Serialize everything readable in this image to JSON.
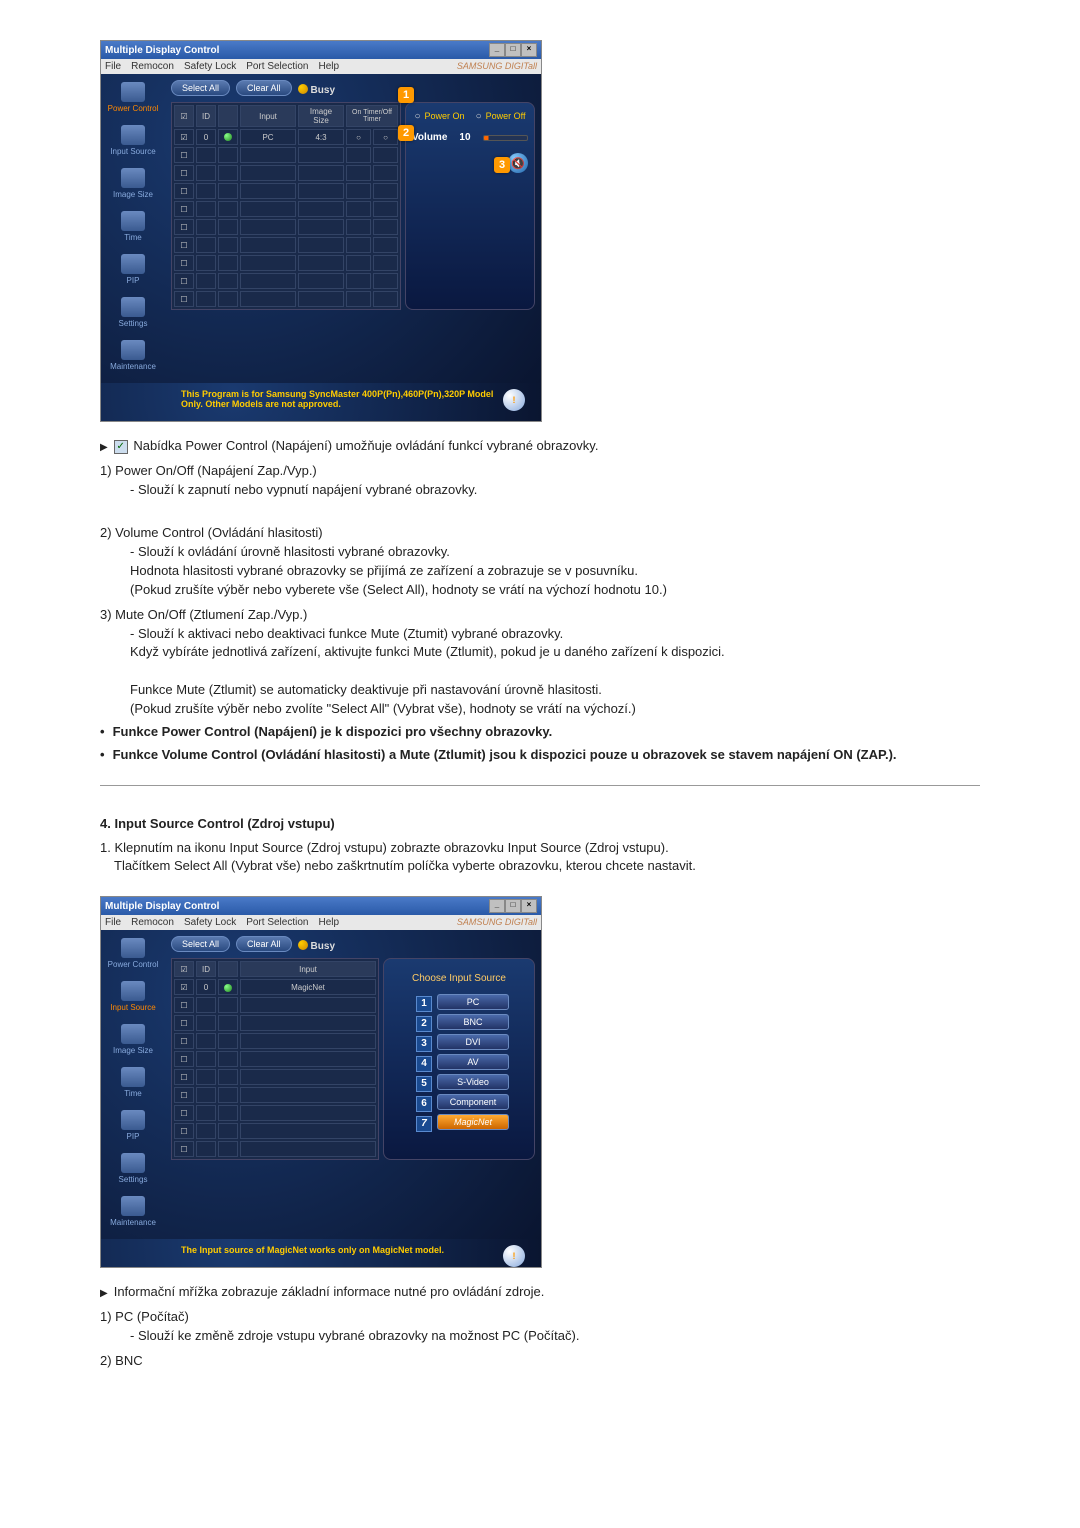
{
  "app": {
    "window_title": "Multiple Display Control",
    "menu": [
      "File",
      "Remocon",
      "Safety Lock",
      "Port Selection",
      "Help"
    ],
    "brand": "SAMSUNG DIGITall"
  },
  "sidebar": {
    "items": [
      {
        "label": "Power Control"
      },
      {
        "label": "Input Source"
      },
      {
        "label": "Image Size"
      },
      {
        "label": "Time"
      },
      {
        "label": "PIP"
      },
      {
        "label": "Settings"
      },
      {
        "label": "Maintenance"
      }
    ]
  },
  "toolbar": {
    "select_all": "Select All",
    "clear_all": "Clear All",
    "busy": "Busy"
  },
  "grid1": {
    "headers": [
      "☑",
      "ID",
      "",
      "Input",
      "Image Size",
      "On Timer/Off Timer"
    ],
    "row": {
      "id": "0",
      "input": "PC",
      "size": "4:3",
      "t1": "○",
      "t2": "○"
    }
  },
  "panel1": {
    "power_on": "Power On",
    "power_off": "Power Off",
    "volume_label": "Volume",
    "volume_value": "10",
    "markers": {
      "m1": "1",
      "m2": "2",
      "m3": "3"
    }
  },
  "footer1": "This Program is for Samsung SyncMaster 400P(Pn),460P(Pn),320P  Model Only. Other Models are not approved.",
  "section1": {
    "intro": "Nabídka Power Control (Napájení) umožňuje ovládání funkcí vybrané obrazovky.",
    "i1_title": "1)  Power On/Off (Napájení Zap./Vyp.)",
    "i1_s1": "Slouží k zapnutí nebo vypnutí napájení vybrané obrazovky.",
    "i2_title": "2)  Volume Control (Ovládání hlasitosti)",
    "i2_s1": "Slouží k ovládání úrovně hlasitosti vybrané obrazovky.",
    "i2_s2": "Hodnota hlasitosti vybrané obrazovky se přijímá ze zařízení a zobrazuje se v posuvníku.",
    "i2_s3": "(Pokud zrušíte výběr nebo vyberete vše (Select All), hodnoty se vrátí na výchozí hodnotu 10.)",
    "i3_title": "3)  Mute On/Off (Ztlumení Zap./Vyp.)",
    "i3_s1": "Slouží k aktivaci nebo deaktivaci funkce Mute (Ztumit) vybrané obrazovky.",
    "i3_s2": "Když vybíráte jednotlivá zařízení, aktivujte funkci Mute (Ztlumit), pokud je u daného zařízení k dispozici.",
    "i3_s3": "Funkce Mute (Ztlumit) se automaticky deaktivuje při nastavování úrovně hlasitosti.",
    "i3_s4": "(Pokud zrušíte výběr nebo zvolíte \"Select All\" (Vybrat vše), hodnoty se vrátí na výchozí.)",
    "b1": "Funkce Power Control (Napájení) je k dispozici pro všechny obrazovky.",
    "b2": "Funkce Volume Control (Ovládání hlasitosti) a Mute (Ztlumit) jsou k dispozici pouze u obrazovek se stavem napájení ON (ZAP.)."
  },
  "section2": {
    "heading": "4. Input Source Control (Zdroj vstupu)",
    "p1": "Klepnutím na ikonu Input Source (Zdroj vstupu) zobrazte obrazovku Input Source (Zdroj vstupu).",
    "p2": "Tlačítkem Select All (Vybrat vše) nebo zaškrtnutím políčka vyberte obrazovku, kterou chcete nastavit."
  },
  "grid2": {
    "headers": [
      "☑",
      "ID",
      "",
      "Input"
    ],
    "row": {
      "id": "0",
      "input": "MagicNet"
    }
  },
  "panel2": {
    "title": "Choose Input Source",
    "sources": [
      {
        "n": "1",
        "label": "PC"
      },
      {
        "n": "2",
        "label": "BNC"
      },
      {
        "n": "3",
        "label": "DVI"
      },
      {
        "n": "4",
        "label": "AV"
      },
      {
        "n": "5",
        "label": "S-Video"
      },
      {
        "n": "6",
        "label": "Component"
      },
      {
        "n": "7",
        "label": "MagicNet"
      }
    ]
  },
  "footer2": "The Input source of MagicNet works only on MagicNet model.",
  "section3": {
    "intro": "Informační mřížka zobrazuje základní informace nutné pro ovládání zdroje.",
    "i1_title": "1)  PC (Počítač)",
    "i1_s1": "Slouží ke změně zdroje vstupu vybrané obrazovky na možnost PC (Počítač).",
    "i2_title": "2)  BNC"
  }
}
